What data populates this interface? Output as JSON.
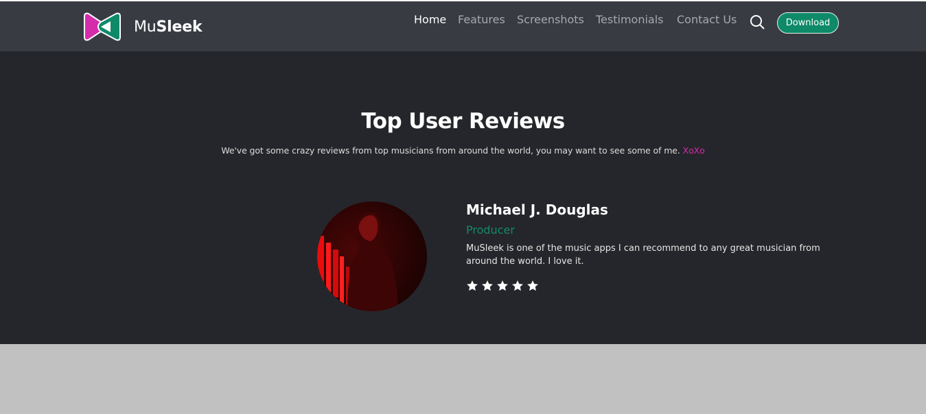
{
  "header": {
    "brand_prefix": "Mu",
    "brand_suffix": "Sleek",
    "nav": [
      "Home",
      "Features",
      "Screenshots",
      "Testimonials",
      "Contact Us"
    ],
    "active_nav": "Home",
    "download_label": "Download",
    "icons": {
      "logo": "musleek-logo-icon",
      "search": "search-icon"
    },
    "colors": {
      "logo_pink": "#d52cac",
      "logo_green": "#0e8a68",
      "download_bg": "#0e8a68"
    }
  },
  "reviews": {
    "title": "Top User Reviews",
    "subtitle": "We've got some crazy reviews from top musicians from around the world, you may want to see some of me.",
    "subtitle_accent": "XoXo",
    "reviewer": {
      "name": "Michael J. Douglas",
      "role": "Producer",
      "text": "MuSleek is one of the music apps I can recommend to any great musician from around the world. I love it.",
      "rating": 5,
      "rating_max": 5
    },
    "colors": {
      "accent_pink": "#d52cac",
      "role_green": "#128b66"
    }
  }
}
